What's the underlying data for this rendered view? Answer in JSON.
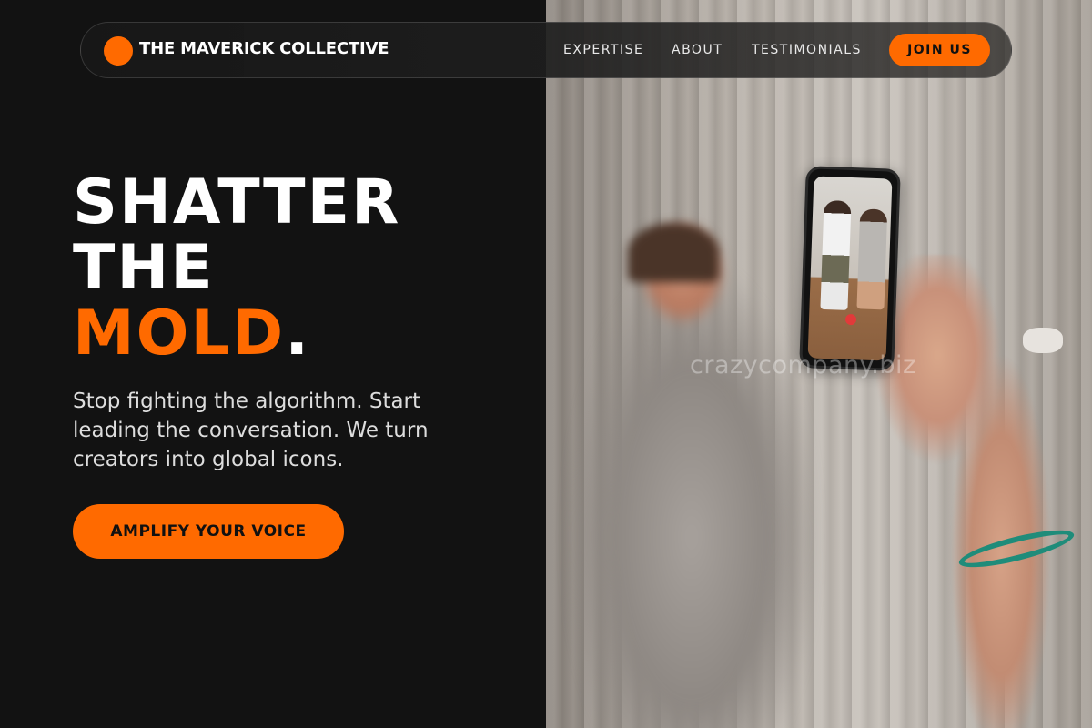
{
  "brand": {
    "name": "THE MAVERICK COLLECTIVE",
    "accent_color": "#ff6a00"
  },
  "nav": {
    "links": [
      "EXPERTISE",
      "ABOUT",
      "TESTIMONIALS"
    ],
    "cta_label": "JOIN US"
  },
  "hero": {
    "headline": {
      "line1": "SHATTER",
      "line2": "THE",
      "accent_word": "MOLD",
      "punctuation": "."
    },
    "subtitle": "Stop fighting the algorithm. Start leading the conversation. We turn creators into global icons.",
    "cta_label": "AMPLIFY YOUR VOICE"
  },
  "image": {
    "watermark": "crazycompany.biz"
  },
  "colors": {
    "background": "#121212",
    "accent": "#ff6a00",
    "text": "#ffffff",
    "muted_text": "#dddddd"
  }
}
